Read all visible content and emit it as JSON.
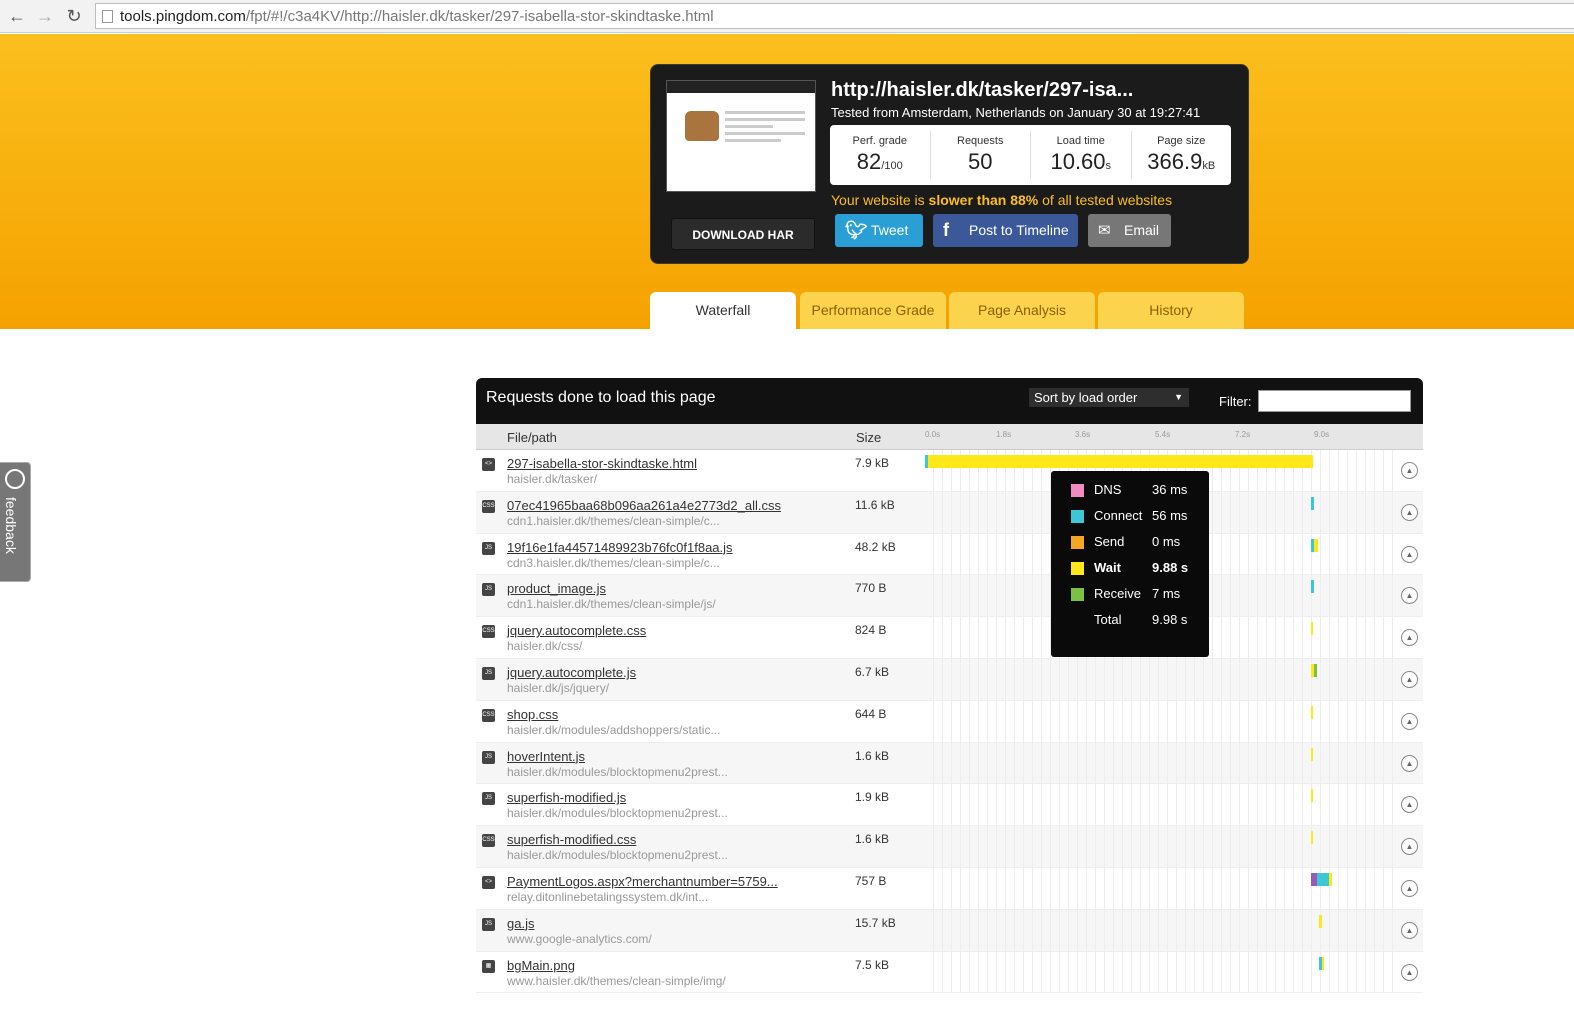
{
  "browser": {
    "url_host": "tools.pingdom.com",
    "url_rest": "/fpt/#!/c3a4KV/http://haisler.dk/tasker/297-isabella-stor-skindtaske.html"
  },
  "summary": {
    "title": "http://haisler.dk/tasker/297-isa...",
    "subtitle": "Tested from Amsterdam, Netherlands on January 30 at 19:27:41",
    "stats": [
      {
        "label": "Perf. grade",
        "value": "82",
        "unit": "/100"
      },
      {
        "label": "Requests",
        "value": "50",
        "unit": ""
      },
      {
        "label": "Load time",
        "value": "10.60",
        "unit": "s"
      },
      {
        "label": "Page size",
        "value": "366.9",
        "unit": "kB"
      }
    ],
    "slower_prefix": "Your website is ",
    "slower_bold": "slower than 88%",
    "slower_suffix": " of all tested websites",
    "download_label": "DOWNLOAD HAR",
    "tweet_label": "Tweet",
    "fb_label": "Post to Timeline",
    "email_label": "Email"
  },
  "tabs": [
    "Waterfall",
    "Performance Grade",
    "Page Analysis",
    "History"
  ],
  "feedback_label": "feedback",
  "panel": {
    "title": "Requests done to load this page",
    "sort_label": "Sort by load order",
    "filter_label": "Filter:",
    "col_file": "File/path",
    "col_size": "Size",
    "ticks": [
      "0.0s",
      "1.8s",
      "3.6s",
      "5.4s",
      "7.2s",
      "9.0s"
    ]
  },
  "requests": [
    {
      "name": "297-isabella-stor-skindtaske.html",
      "path": "haisler.dk/tasker/",
      "size": "7.9 kB",
      "type": "html",
      "start_s": 0.0,
      "wait_s": 9.88
    },
    {
      "name": "07ec41965baa68b096aa261a4e2773d2_all.css",
      "path": "cdn1.haisler.dk/themes/clean-simple/c...",
      "size": "11.6 kB",
      "type": "css"
    },
    {
      "name": "19f16e1fa44571489923b76fc0f1f8aa.js",
      "path": "cdn3.haisler.dk/themes/clean-simple/c...",
      "size": "48.2 kB",
      "type": "js"
    },
    {
      "name": "product_image.js",
      "path": "cdn1.haisler.dk/themes/clean-simple/js/",
      "size": "770 B",
      "type": "js"
    },
    {
      "name": "jquery.autocomplete.css",
      "path": "haisler.dk/css/",
      "size": "824 B",
      "type": "css"
    },
    {
      "name": "jquery.autocomplete.js",
      "path": "haisler.dk/js/jquery/",
      "size": "6.7 kB",
      "type": "js"
    },
    {
      "name": "shop.css",
      "path": "haisler.dk/modules/addshoppers/static...",
      "size": "644 B",
      "type": "css"
    },
    {
      "name": "hoverIntent.js",
      "path": "haisler.dk/modules/blocktopmenu2prest...",
      "size": "1.6 kB",
      "type": "js"
    },
    {
      "name": "superfish-modified.js",
      "path": "haisler.dk/modules/blocktopmenu2prest...",
      "size": "1.9 kB",
      "type": "js"
    },
    {
      "name": "superfish-modified.css",
      "path": "haisler.dk/modules/blocktopmenu2prest...",
      "size": "1.6 kB",
      "type": "css"
    },
    {
      "name": "PaymentLogos.aspx?merchantnumber=5759...",
      "path": "relay.ditonlinebetalingssystem.dk/int...",
      "size": "757 B",
      "type": "html"
    },
    {
      "name": "ga.js",
      "path": "www.google-analytics.com/",
      "size": "15.7 kB",
      "type": "js"
    },
    {
      "name": "bgMain.png",
      "path": "www.haisler.dk/themes/clean-simple/img/",
      "size": "7.5 kB",
      "type": "img"
    }
  ],
  "tooltip": [
    {
      "label": "DNS",
      "value": "36 ms",
      "color": "#f08cc0"
    },
    {
      "label": "Connect",
      "value": "56 ms",
      "color": "#3cc6d6"
    },
    {
      "label": "Send",
      "value": "0 ms",
      "color": "#f5a623"
    },
    {
      "label": "Wait",
      "value": "9.88 s",
      "color": "#ffe81a",
      "bold": true
    },
    {
      "label": "Receive",
      "value": "7 ms",
      "color": "#7cc242"
    },
    {
      "label": "Total",
      "value": "9.98 s",
      "color": ""
    }
  ]
}
